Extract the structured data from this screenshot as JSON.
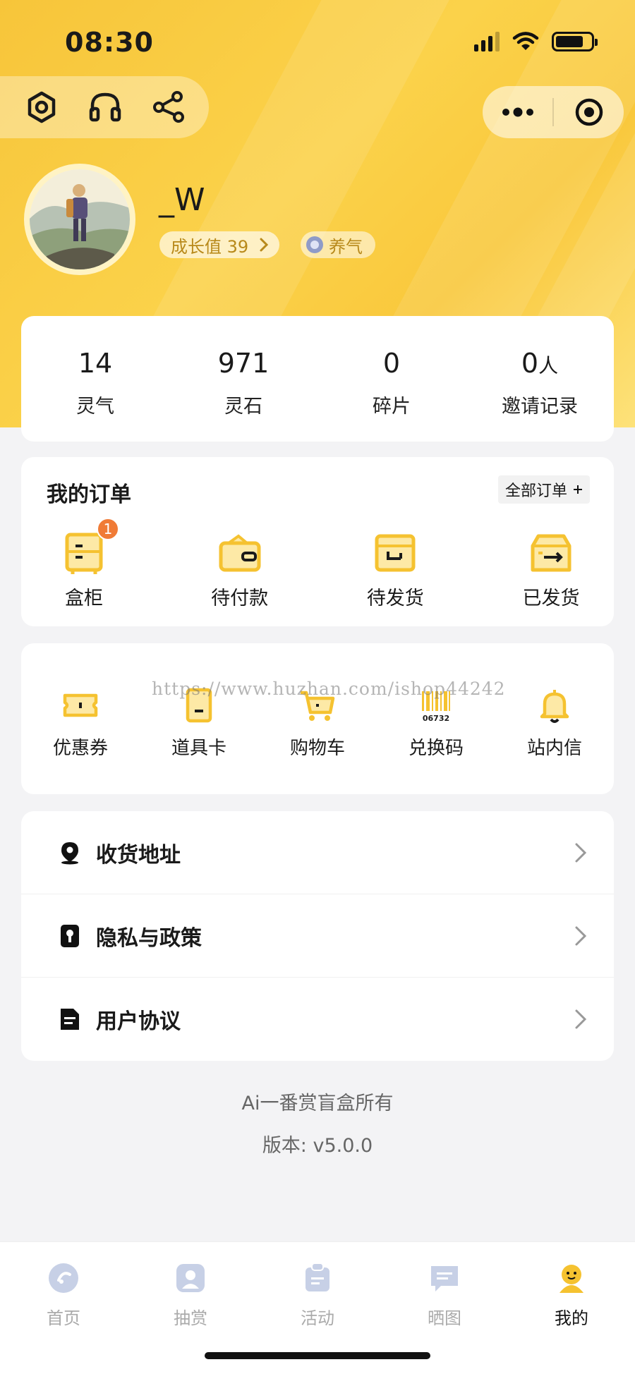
{
  "status": {
    "time": "08:30"
  },
  "profile": {
    "username": "_W",
    "growth_label": "成长值 39",
    "level_label": "养气"
  },
  "stats": [
    {
      "value": "14",
      "unit": "",
      "label": "灵气"
    },
    {
      "value": "971",
      "unit": "",
      "label": "灵石"
    },
    {
      "value": "0",
      "unit": "",
      "label": "碎片"
    },
    {
      "value": "0",
      "unit": "人",
      "label": "邀请记录"
    }
  ],
  "orders": {
    "title": "我的订单",
    "all_label": "全部订单",
    "items": [
      {
        "label": "盒柜",
        "badge": "1",
        "icon": "box-cabinet-icon"
      },
      {
        "label": "待付款",
        "icon": "wallet-icon"
      },
      {
        "label": "待发货",
        "icon": "package-icon"
      },
      {
        "label": "已发货",
        "icon": "shipped-icon"
      }
    ]
  },
  "tools": {
    "items": [
      {
        "label": "优惠券",
        "icon": "coupon-icon"
      },
      {
        "label": "道具卡",
        "icon": "item-card-icon"
      },
      {
        "label": "购物车",
        "icon": "cart-icon"
      },
      {
        "label": "兑换码",
        "icon": "barcode-icon"
      },
      {
        "label": "站内信",
        "icon": "bell-icon"
      }
    ],
    "watermark": "https://www.huzhan.com/ishop44242"
  },
  "menu": [
    {
      "label": "收货地址",
      "icon": "location-icon"
    },
    {
      "label": "隐私与政策",
      "icon": "privacy-icon"
    },
    {
      "label": "用户协议",
      "icon": "document-icon"
    }
  ],
  "footer": {
    "owner": "Ai一番赏盲盒所有",
    "version": "版本: v5.0.0"
  },
  "tabbar": [
    {
      "label": "首页",
      "icon": "home-icon",
      "active": false
    },
    {
      "label": "抽赏",
      "icon": "draw-icon",
      "active": false
    },
    {
      "label": "活动",
      "icon": "activity-icon",
      "active": false
    },
    {
      "label": "晒图",
      "icon": "share-photo-icon",
      "active": false
    },
    {
      "label": "我的",
      "icon": "profile-icon",
      "active": true
    }
  ],
  "colors": {
    "brand": "#f9c83c",
    "icon_yellow": "#f5c230",
    "badge": "#f07b36",
    "badge_text": "#b8891a"
  }
}
